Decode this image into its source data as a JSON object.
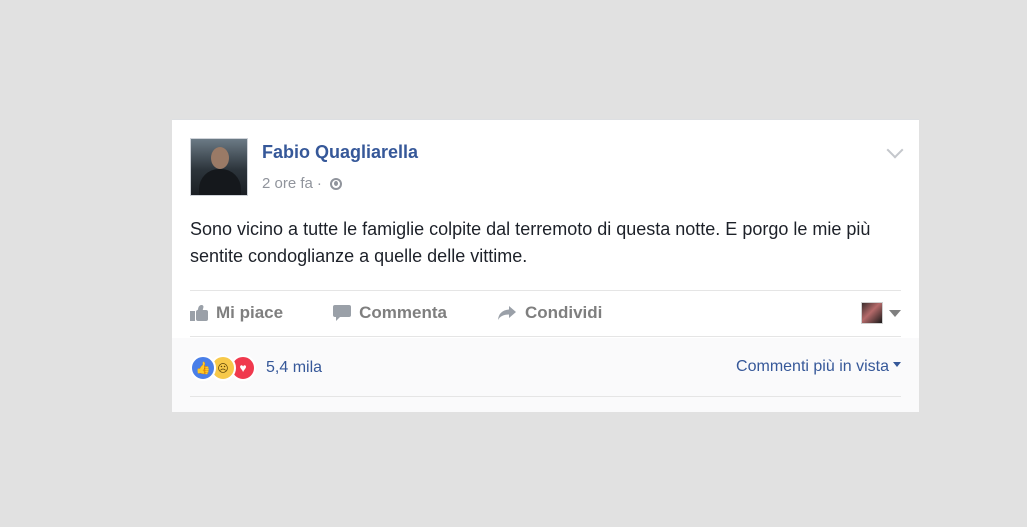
{
  "post": {
    "author": "Fabio Quagliarella",
    "timestamp": "2 ore fa",
    "separator": "·",
    "privacy_icon": "globe-icon",
    "text": "Sono vicino a tutte le famiglie colpite dal terremoto di questa notte. E porgo le mie più sentite condoglianze a quelle delle vittime."
  },
  "actions": {
    "like_label": "Mi piace",
    "comment_label": "Commenta",
    "share_label": "Condividi"
  },
  "reactions": {
    "icons": [
      "like-icon",
      "sad-icon",
      "love-icon"
    ],
    "count": "5,4 mila"
  },
  "comments": {
    "sort_label": "Commenti più in vista"
  },
  "colors": {
    "link": "#365899",
    "text": "#1d2129",
    "muted": "#90949c",
    "background": "#e1e1e1"
  }
}
